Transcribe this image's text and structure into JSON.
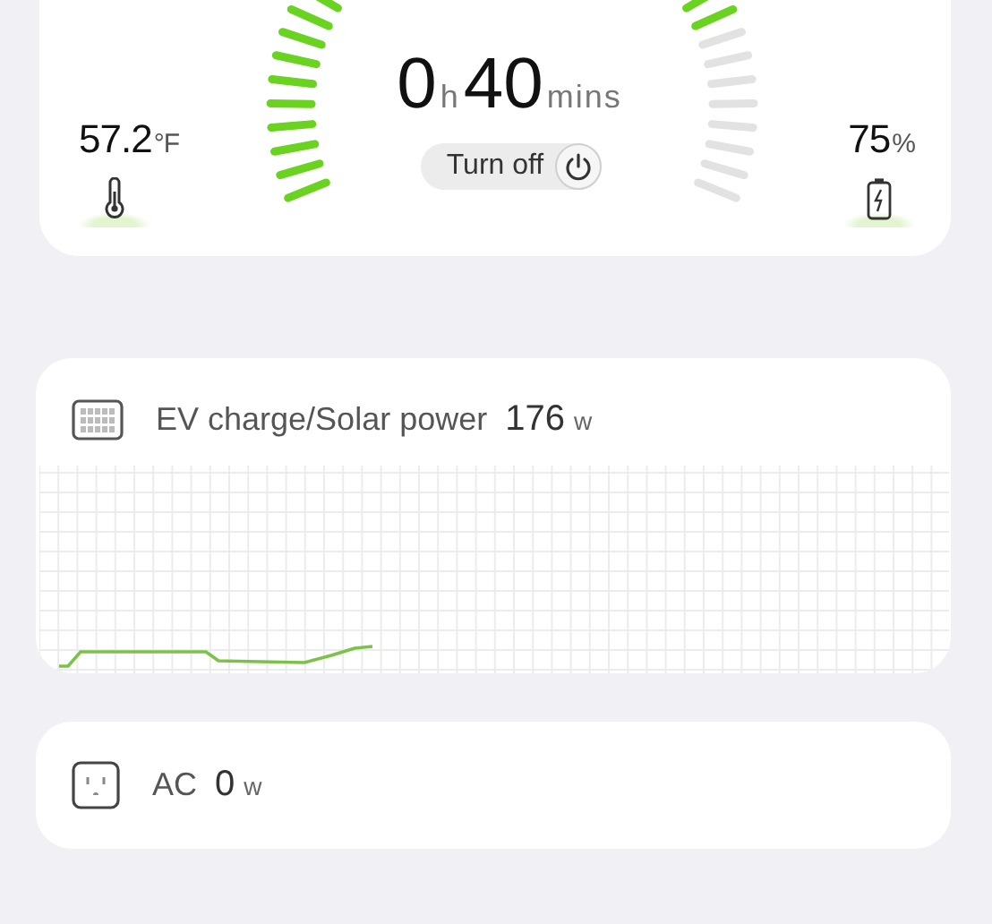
{
  "gauge": {
    "hours": "0",
    "hours_unit": "h",
    "minutes": "40",
    "minutes_unit": "mins",
    "level": 0.8
  },
  "turn_off_button": {
    "label": "Turn off"
  },
  "temperature": {
    "value": "57.2",
    "unit": "°F"
  },
  "battery": {
    "value": "75",
    "unit": "%"
  },
  "panels": [
    {
      "kind": "solar",
      "title": "EV charge/Solar power",
      "value": "176",
      "unit": "w"
    },
    {
      "kind": "ac",
      "title": "AC",
      "value": "0",
      "unit": "w"
    }
  ]
}
